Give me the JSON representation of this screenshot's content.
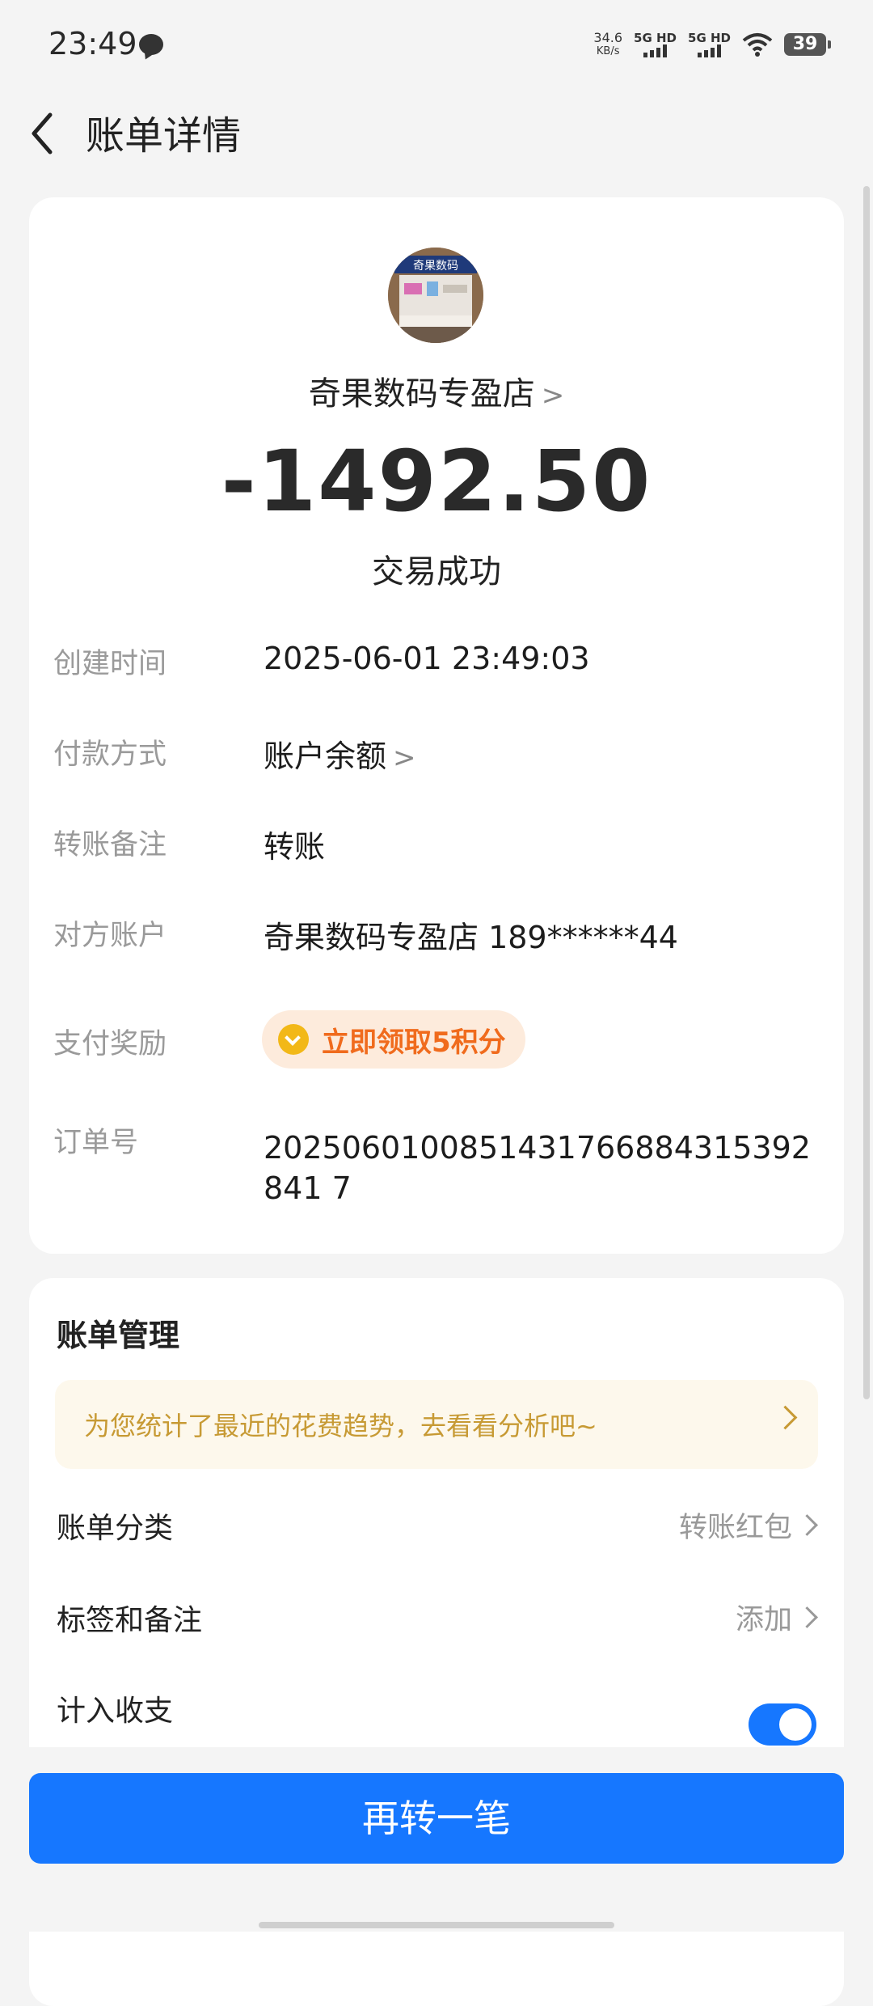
{
  "status_bar": {
    "time": "23:49",
    "net_speed": "34.6",
    "net_speed_unit": "KB/s",
    "sim1": "5G HD",
    "sim2": "5G HD",
    "battery": "39"
  },
  "header": {
    "title": "账单详情"
  },
  "transaction": {
    "merchant": "奇果数码专盈店",
    "merchant_chevron": ">",
    "amount": "-1492.50",
    "status": "交易成功",
    "avatar_text": "奇果数码"
  },
  "details": {
    "created_label": "创建时间",
    "created_value": "2025-06-01 23:49:03",
    "payment_label": "付款方式",
    "payment_value": "账户余额",
    "payment_chevron": ">",
    "remark_label": "转账备注",
    "remark_value": "转账",
    "counterparty_label": "对方账户",
    "counterparty_value": "奇果数码专盈店 189******44",
    "reward_label": "支付奖励",
    "reward_value": "立即领取5积分",
    "order_label": "订单号",
    "order_value": "2025060100851431766884315392841 7"
  },
  "management": {
    "title": "账单管理",
    "tip": "为您统计了最近的花费趋势，去看看分析吧~",
    "category_label": "账单分类",
    "category_value": "转账红包",
    "tags_label": "标签和备注",
    "tags_value": "添加",
    "include_label": "计入收支",
    "include_on": true
  },
  "actions": {
    "transfer_again": "再转一笔"
  },
  "colors": {
    "accent": "#1677ff",
    "reward": "#f06b1d",
    "tip": "#c79a34"
  }
}
